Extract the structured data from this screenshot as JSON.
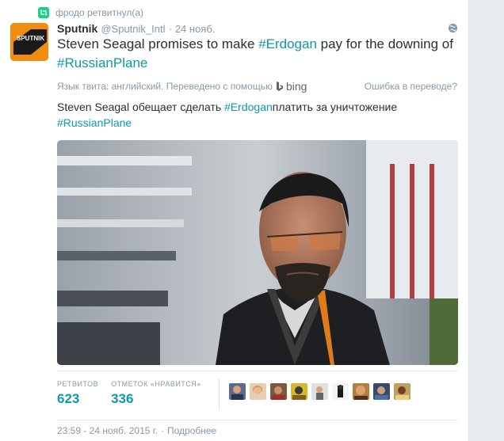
{
  "retweet": {
    "text": "фродо ретвитнул(а)"
  },
  "tweet": {
    "author_name": "Sputnik",
    "handle": "@Sputnik_Intl",
    "dot": "·",
    "time": "24 нояб.",
    "text_before": "Steven Seagal promises to make ",
    "hashtag1": "#Erdogan",
    "text_middle": " pay for the downing of ",
    "hashtag2": "#RussianPlane"
  },
  "translation": {
    "lang_note": "Язык твита: английский. Переведено с помощью",
    "engine": "bing",
    "error_link": "Ошибка в переводе?",
    "text_before": "Steven Seagal обещает сделать ",
    "hashtag1": "#Erdogan",
    "text_middle": "платить за уничтожение",
    "hashtag2": "#RussianPlane"
  },
  "stats": {
    "retweets_label": "РЕТВИТОВ",
    "retweets_value": "623",
    "likes_label": "ОТМЕТОК «НРАВИТСЯ»",
    "likes_value": "336"
  },
  "footer": {
    "timestamp": "23:59 - 24 нояб. 2015 г.",
    "dot": "·",
    "details": "Подробнее"
  },
  "colors": {
    "accent": "#0f98a9",
    "retweet_green": "#19cf86",
    "avatar_orange": "#f28c0f",
    "muted": "#8899a6"
  },
  "icons": {
    "retweet": "retweet-icon",
    "globe": "globe-icon",
    "bing": "bing-logo"
  }
}
